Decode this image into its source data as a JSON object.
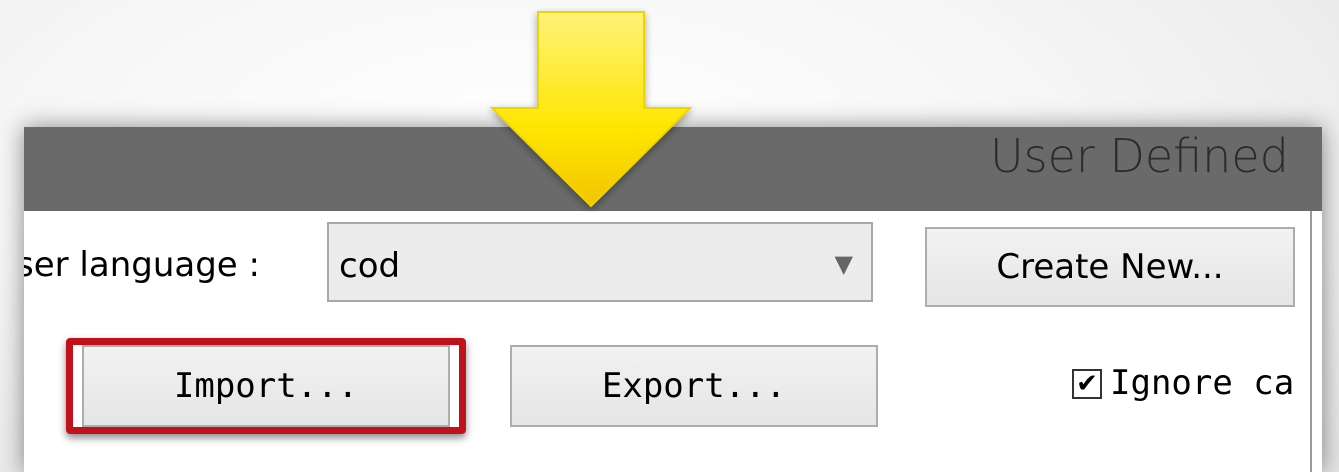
{
  "window": {
    "title": "User Defined"
  },
  "language": {
    "label": "ser language :",
    "selected": "cod"
  },
  "buttons": {
    "create_new": "Create New...",
    "import": "Import...",
    "export": "Export..."
  },
  "options": {
    "ignore_case_label": "Ignore ca",
    "ignore_case_checked": true
  },
  "icons": {
    "dropdown": "chevron-down-icon",
    "checkbox": "checkmark-icon",
    "pointer": "arrow-down-icon"
  },
  "colors": {
    "titlebar": "#6a6a6a",
    "highlight": "#c0121c",
    "arrow": "#ffe81a"
  }
}
